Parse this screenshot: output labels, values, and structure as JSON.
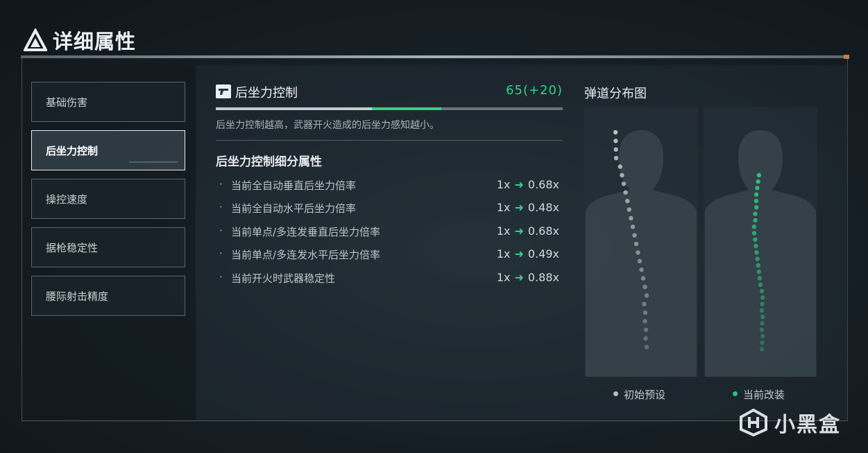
{
  "header": {
    "title": "详细属性",
    "logo_icon": "triangle-logo-icon"
  },
  "sidebar": {
    "items": [
      {
        "label": "基础伤害",
        "active": false
      },
      {
        "label": "后坐力控制",
        "active": true
      },
      {
        "label": "操控速度",
        "active": false
      },
      {
        "label": "据枪稳定性",
        "active": false
      },
      {
        "label": "腰际射击精度",
        "active": false
      }
    ]
  },
  "attribute": {
    "icon": "pistol-icon",
    "title": "后坐力控制",
    "value": "65(+20)",
    "base_fraction": 0.45,
    "bonus_fraction": 0.2,
    "description": "后坐力控制越高，武器开火造成的后坐力感知越小。"
  },
  "details": {
    "title": "后坐力控制细分属性",
    "rows": [
      {
        "label": "当前全自动垂直后坐力倍率",
        "from": "1x",
        "to": "0.68x"
      },
      {
        "label": "当前全自动水平后坐力倍率",
        "from": "1x",
        "to": "0.48x"
      },
      {
        "label": "当前单点/多连发垂直后坐力倍率",
        "from": "1x",
        "to": "0.68x"
      },
      {
        "label": "当前单点/多连发水平后坐力倍率",
        "from": "1x",
        "to": "0.49x"
      },
      {
        "label": "当前开火时武器稳定性",
        "from": "1x",
        "to": "0.88x"
      }
    ]
  },
  "spray": {
    "title": "弹道分布图",
    "legend_initial": "初始预设",
    "legend_current": "当前改装",
    "colors": {
      "initial": "#b9c0c4",
      "current": "#2fc07a",
      "accent": "#37d18b"
    }
  },
  "watermark": {
    "text": "小黑盒"
  }
}
